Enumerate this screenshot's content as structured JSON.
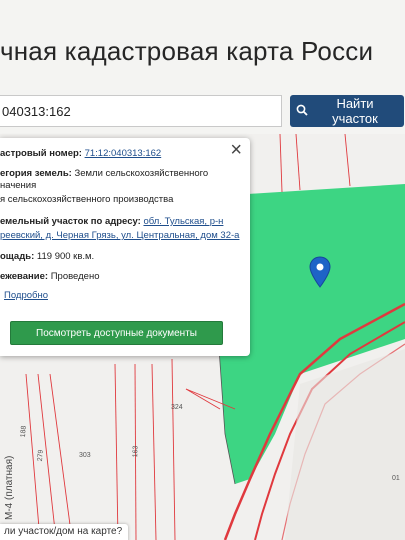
{
  "page": {
    "title": "чная кадастровая карта Росси"
  },
  "search": {
    "value": "040313:162",
    "button_label": "Найти участок"
  },
  "popup": {
    "cadastral_label": "астровый номер:",
    "cadastral_value": "71:12:040313:162",
    "category_label": "егория земель:",
    "category_line1": "Земли сельскохозяйственного",
    "category_line2": "начения",
    "usage_line": "я сельскохозяйственного производства",
    "address_label": "емельный участок по адресу:",
    "address_link1": "обл. Тульская, р-н",
    "address_link2": "реевский, д. Черная Грязь, ул. Центральная, дом 32-а",
    "area_label": "ощадь:",
    "area_value": "119 900 кв.м.",
    "survey_label": "ежевание:",
    "survey_value": "Проведено",
    "more_link": "Подробно",
    "docs_button": "Посмотреть доступные документы"
  },
  "map": {
    "labels": {
      "plot_324": "324",
      "plot_303": "303",
      "plot_163": "163",
      "plot_279": "279",
      "plot_188": "188",
      "plot_01": "01"
    },
    "road_label": "М-4 (платная)",
    "colors": {
      "parcel_fill": "#2ed27a",
      "border_red": "#e0393e",
      "background": "#f1f0ee"
    }
  },
  "bottom_bar": {
    "text": "ли участок/дом на карте?"
  }
}
